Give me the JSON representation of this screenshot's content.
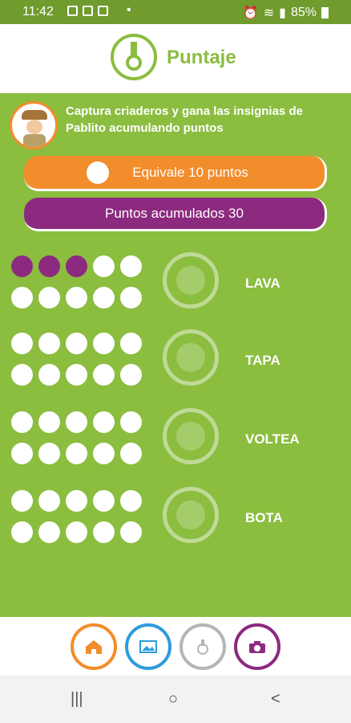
{
  "status": {
    "time": "11:42",
    "battery": "85%"
  },
  "header": {
    "title": "Puntaje"
  },
  "intro": {
    "text": "Captura criaderos y gana las insignias de Pablito acumulando puntos"
  },
  "buttons": {
    "equivalence": "Equivale 10 puntos",
    "accumulated": "Puntos acumulados 30"
  },
  "sections": [
    {
      "label": "LAVA",
      "filled": 3,
      "total": 10
    },
    {
      "label": "TAPA",
      "filled": 0,
      "total": 10
    },
    {
      "label": "VOLTEA",
      "filled": 0,
      "total": 10
    },
    {
      "label": "BOTA",
      "filled": 0,
      "total": 10
    }
  ],
  "colors": {
    "green": "#8bbd3f",
    "orange": "#f28d2b",
    "purple": "#8c2a7f",
    "gray": "#b5b5b5",
    "blue": "#2d9cdb"
  },
  "nav": {
    "icons": [
      "home-icon",
      "gallery-icon",
      "medal-icon",
      "camera-icon"
    ]
  },
  "system_nav": {
    "recent": "|||",
    "home": "○",
    "back": "<"
  }
}
